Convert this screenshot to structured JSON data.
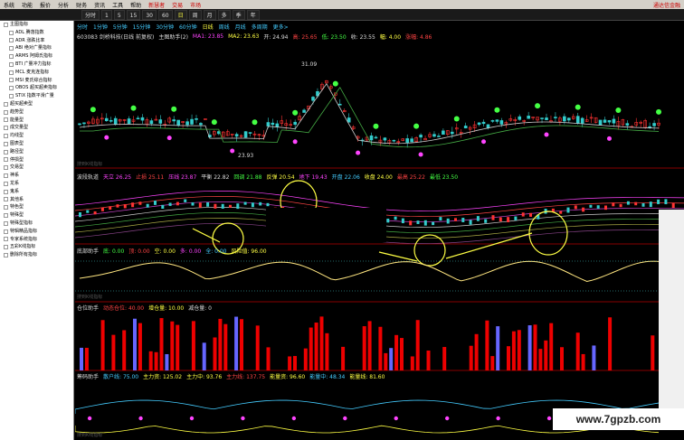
{
  "menubar": {
    "items": [
      "系统",
      "功能",
      "报价",
      "分析",
      "财务",
      "资讯",
      "工具",
      "帮助",
      "新慧者",
      "交易",
      "市场"
    ],
    "right_note": "通达信金融"
  },
  "toolbar": {
    "buttons": [
      "分时",
      "1",
      "5",
      "15",
      "30",
      "60",
      "日",
      "周",
      "月",
      "多",
      "季",
      "年"
    ]
  },
  "lefttree": {
    "items": [
      {
        "label": "主图指标",
        "level": 1
      },
      {
        "label": "ADL 腾落指数",
        "level": 2
      },
      {
        "label": "ADR 涨跌比率",
        "level": 2
      },
      {
        "label": "ABI 绝对广量指标",
        "level": 2
      },
      {
        "label": "ARMS 阿姆氏指标",
        "level": 2
      },
      {
        "label": "BTI 广量冲力指标",
        "level": 2
      },
      {
        "label": "MCL 麦克连指标",
        "level": 2
      },
      {
        "label": "MSI 麦氏综合指标",
        "level": 2
      },
      {
        "label": "OBOS 超买超卖指标",
        "level": 2
      },
      {
        "label": "STIX 指数平滑广量",
        "level": 2
      },
      {
        "label": "超买超卖型",
        "level": 1
      },
      {
        "label": "趋势型",
        "level": 1
      },
      {
        "label": "能量型",
        "level": 1
      },
      {
        "label": "成交量型",
        "level": 1
      },
      {
        "label": "均线型",
        "level": 1
      },
      {
        "label": "图表型",
        "level": 1
      },
      {
        "label": "路径型",
        "level": 1
      },
      {
        "label": "停损型",
        "level": 1
      },
      {
        "label": "交易型",
        "level": 1
      },
      {
        "label": "神系",
        "level": 1
      },
      {
        "label": "龙系",
        "level": 1
      },
      {
        "label": "鬼系",
        "level": 1
      },
      {
        "label": "其他系",
        "level": 1
      },
      {
        "label": "特色型",
        "level": 1
      },
      {
        "label": "特殊型",
        "level": 1
      },
      {
        "label": "特殊型指标",
        "level": 1
      },
      {
        "label": "特辑精品指标",
        "level": 1
      },
      {
        "label": "专家系统指标",
        "level": 1
      },
      {
        "label": "五彩K线指标",
        "level": 1
      },
      {
        "label": "删除所有指标",
        "level": 1
      }
    ]
  },
  "chart": {
    "tabs": [
      "分时",
      "1分钟",
      "5分钟",
      "15分钟",
      "30分钟",
      "60分钟",
      "日线",
      "周线",
      "月线",
      "多周期",
      "更多>"
    ],
    "active_tab": "日线",
    "main_header": {
      "title": "603083 剑桥科技(日线 前复权)",
      "indicator": "主图助手(2)",
      "ma1": "MA1: 23.85",
      "ma2": "MA2: 23.63",
      "open": "开: 24.94",
      "high": "高: 25.65",
      "low": "低: 23.50",
      "close": "收: 23.55",
      "chg_amt": "幅: 4.00",
      "chg_pct": "涨幅: 4.86"
    },
    "price_high_label": "31.09",
    "price_low_label": "23.93",
    "pane2_header": {
      "name": "波段轨道",
      "v1": "天立 26.25",
      "v2": "止损 25.11",
      "v3": "压线 23.87",
      "v4": "平衡 22.82",
      "v5": "回调 21.88",
      "v6": "反弹 20.54",
      "v7": "地下 19.43",
      "v8": "开盘 22.06",
      "v9": "收盘 24.00",
      "v10": "最高 25.22",
      "v11": "最低 23.50"
    },
    "pane3_header": {
      "name": "底部助手",
      "v1": "底: 0.00",
      "v2": "顶: 0.00",
      "v3": "空: 0.00",
      "v4": "多: 0.00",
      "v5": "全: 0.00",
      "v6": "风险值: 96.00"
    },
    "pane4_header": {
      "name": "仓位助手",
      "v1": "动态仓位: 40.00",
      "v2": "增仓量: 10.00",
      "v3": "减仓量: 0"
    },
    "pane5_header": {
      "name": "筹码助手",
      "v1": "散户线: 75.00",
      "v2": "主力资: 125.02",
      "v3": "主力中: 93.76",
      "v4": "主力线: 137.75",
      "v5": "能量资: 96.60",
      "v6": "能量中: 48.34",
      "v7": "能量线: 81.60"
    },
    "footer_label": "搜到K线指标"
  },
  "watermark": "www.7gpzb.com",
  "colors": {
    "up": "#ff3333",
    "down": "#33cccc",
    "yellow": "#ffff44",
    "magenta": "#ff44ff",
    "green": "#44ff44"
  }
}
